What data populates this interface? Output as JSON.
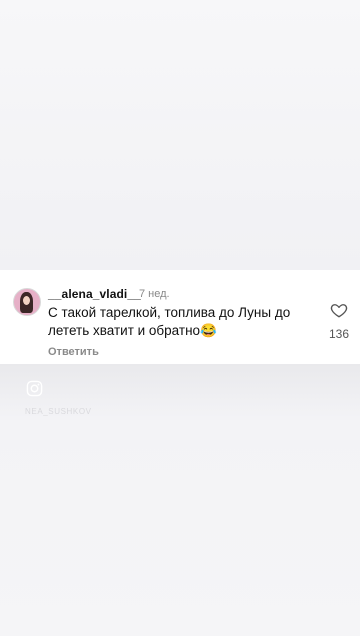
{
  "comment": {
    "username": "__alena_vladi__",
    "time": "7 нед.",
    "text": "С такой тарелкой, топлива до Луны до лететь хватит  и обратно😂",
    "reply_label": "Ответить",
    "like_count": "136",
    "avatar_icon": "user-avatar",
    "like_icon": "heart-outline-icon"
  },
  "watermark": {
    "icon": "instagram-icon",
    "text": "NEA_SUSHKOV"
  }
}
